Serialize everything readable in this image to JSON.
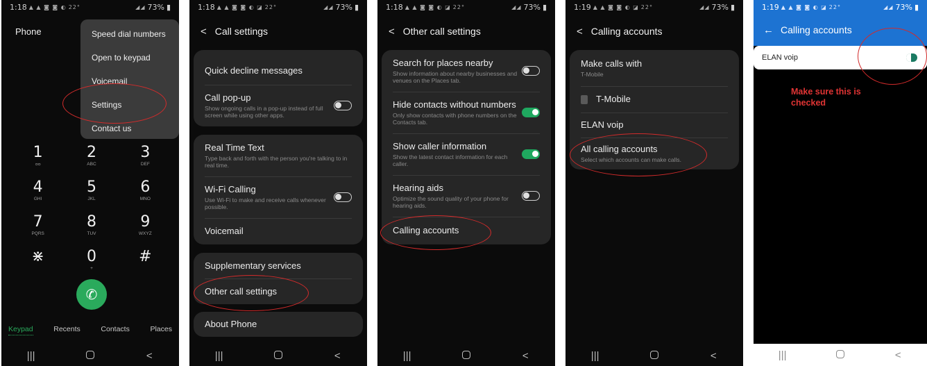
{
  "status_bar": [
    {
      "time": "1:18",
      "temp": "22°",
      "battery": "73%"
    },
    {
      "time": "1:18",
      "temp": "22°",
      "battery": "73%"
    },
    {
      "time": "1:18",
      "temp": "22°",
      "battery": "73%"
    },
    {
      "time": "1:19",
      "temp": "22°",
      "battery": "73%"
    },
    {
      "time": "1:19",
      "temp": "22°",
      "battery": "73%"
    }
  ],
  "nav": {
    "recents": "|||",
    "home": "",
    "back": "<"
  },
  "screen1": {
    "title": "Phone",
    "menu": [
      "Speed dial numbers",
      "Open to keypad",
      "Voicemail",
      "Settings",
      "Contact us"
    ],
    "keys": [
      [
        {
          "n": "1",
          "l": "ᴑᴑ"
        },
        {
          "n": "2",
          "l": "ABC"
        },
        {
          "n": "3",
          "l": "DEF"
        }
      ],
      [
        {
          "n": "4",
          "l": "GHI"
        },
        {
          "n": "5",
          "l": "JKL"
        },
        {
          "n": "6",
          "l": "MNO"
        }
      ],
      [
        {
          "n": "7",
          "l": "PQRS"
        },
        {
          "n": "8",
          "l": "TUV"
        },
        {
          "n": "9",
          "l": "WXYZ"
        }
      ],
      [
        {
          "n": "⋇",
          "l": ""
        },
        {
          "n": "0",
          "l": "+"
        },
        {
          "n": "#",
          "l": ""
        }
      ]
    ],
    "tabs": [
      "Keypad",
      "Recents",
      "Contacts",
      "Places"
    ]
  },
  "screen2": {
    "title": "Call settings",
    "quick_decline": "Quick decline messages",
    "call_popup_title": "Call pop-up",
    "call_popup_sub": "Show ongoing calls in a pop-up instead of full screen while using other apps.",
    "rtt_title": "Real Time Text",
    "rtt_sub": "Type back and forth with the person you're talking to in real time.",
    "wifi_title": "Wi-Fi Calling",
    "wifi_sub": "Use Wi-Fi to make and receive calls whenever possible.",
    "voicemail": "Voicemail",
    "supplementary": "Supplementary services",
    "other": "Other call settings",
    "about": "About Phone"
  },
  "screen3": {
    "title": "Other call settings",
    "search_title": "Search for places nearby",
    "search_sub": "Show information about nearby businesses and venues on the Places tab.",
    "hide_title": "Hide contacts without numbers",
    "hide_sub": "Only show contacts with phone numbers on the Contacts tab.",
    "caller_title": "Show caller information",
    "caller_sub": "Show the latest contact information for each caller.",
    "hearing_title": "Hearing aids",
    "hearing_sub": "Optimize the sound quality of your phone for hearing aids.",
    "calling_accounts": "Calling accounts"
  },
  "screen4": {
    "title": "Calling accounts",
    "make_calls_title": "Make calls with",
    "make_calls_sub": "T-Mobile",
    "tmobile": "T-Mobile",
    "elan": "ELAN voip",
    "all_title": "All calling accounts",
    "all_sub": "Select which accounts can make calls."
  },
  "screen5": {
    "title": "Calling accounts",
    "elan": "ELAN voip",
    "note": "Make sure this is checked"
  },
  "colors": {
    "accent_green": "#1fa85f",
    "annotation_red": "#d22b2b",
    "app_blue": "#1d73d2"
  }
}
